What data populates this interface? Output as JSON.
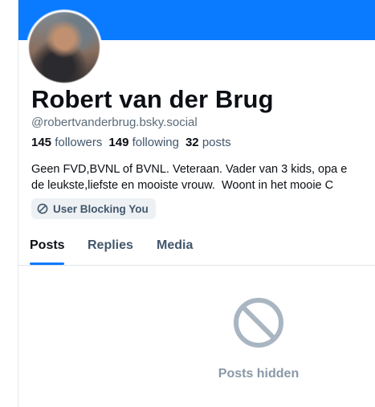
{
  "profile": {
    "display_name": "Robert van der Brug",
    "handle": "@robertvanderbrug.bsky.social",
    "stats": {
      "followers_count": "145",
      "followers_label": "followers",
      "following_count": "149",
      "following_label": "following",
      "posts_count": "32",
      "posts_label": "posts"
    },
    "bio_lines": [
      "Geen FVD,BVNL of BVNL. Veteraan. Vader van 3 kids, opa e",
      "de leukste,liefste en mooiste vrouw.  Woont in het mooie C"
    ],
    "badge_label": "User Blocking You"
  },
  "tabs": [
    {
      "label": "Posts",
      "active": true
    },
    {
      "label": "Replies",
      "active": false
    },
    {
      "label": "Media",
      "active": false
    }
  ],
  "feed": {
    "empty_icon": "no-entry-icon",
    "empty_message": "Posts hidden"
  },
  "colors": {
    "banner": "#0a7aff",
    "accent": "#0a7aff",
    "muted_text": "#42576c",
    "hidden_icon": "#a9b6c2"
  }
}
